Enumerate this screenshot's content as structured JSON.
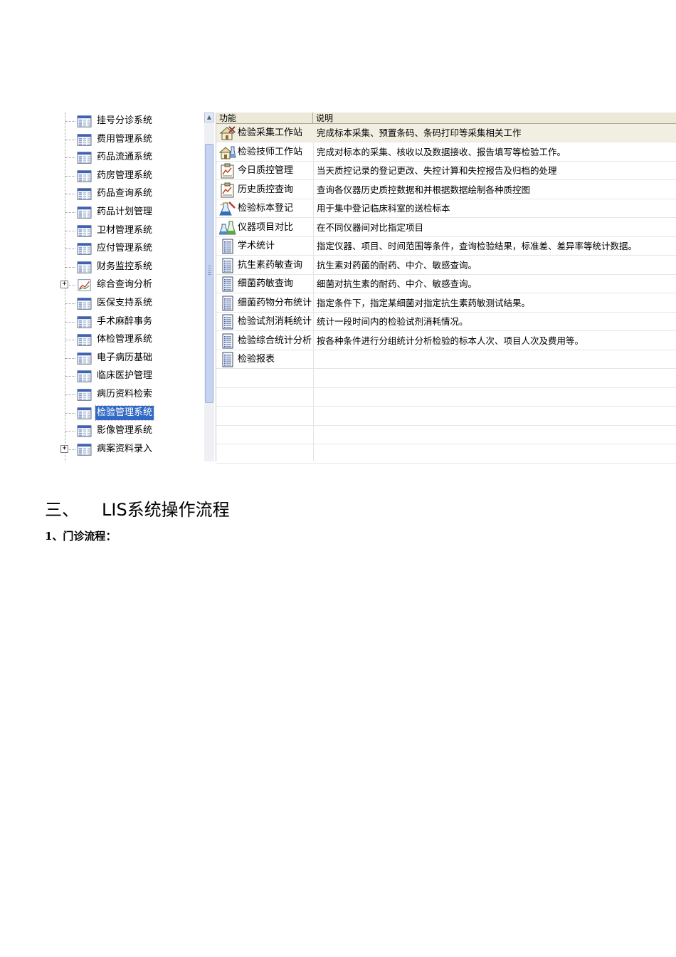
{
  "tree": {
    "items": [
      {
        "label": "挂号分诊系统",
        "expandable": false,
        "selected": false,
        "icon": "table-window-icon"
      },
      {
        "label": "费用管理系统",
        "expandable": false,
        "selected": false,
        "icon": "table-window-icon"
      },
      {
        "label": "药品流通系统",
        "expandable": false,
        "selected": false,
        "icon": "table-window-icon"
      },
      {
        "label": "药房管理系统",
        "expandable": false,
        "selected": false,
        "icon": "table-window-icon"
      },
      {
        "label": "药品查询系统",
        "expandable": false,
        "selected": false,
        "icon": "table-window-icon"
      },
      {
        "label": "药品计划管理",
        "expandable": false,
        "selected": false,
        "icon": "table-window-icon"
      },
      {
        "label": "卫材管理系统",
        "expandable": false,
        "selected": false,
        "icon": "table-window-icon"
      },
      {
        "label": "应付管理系统",
        "expandable": false,
        "selected": false,
        "icon": "table-window-icon"
      },
      {
        "label": "财务监控系统",
        "expandable": false,
        "selected": false,
        "icon": "table-window-icon"
      },
      {
        "label": "综合查询分析",
        "expandable": true,
        "selected": false,
        "icon": "chart-icon"
      },
      {
        "label": "医保支持系统",
        "expandable": false,
        "selected": false,
        "icon": "table-window-icon"
      },
      {
        "label": "手术麻醉事务",
        "expandable": false,
        "selected": false,
        "icon": "table-window-icon"
      },
      {
        "label": "体检管理系统",
        "expandable": false,
        "selected": false,
        "icon": "table-window-icon"
      },
      {
        "label": "电子病历基础",
        "expandable": false,
        "selected": false,
        "icon": "table-window-icon"
      },
      {
        "label": "临床医护管理",
        "expandable": false,
        "selected": false,
        "icon": "table-window-icon"
      },
      {
        "label": "病历资料检索",
        "expandable": false,
        "selected": false,
        "icon": "table-window-icon"
      },
      {
        "label": "检验管理系统",
        "expandable": false,
        "selected": true,
        "icon": "table-window-icon"
      },
      {
        "label": "影像管理系统",
        "expandable": false,
        "selected": false,
        "icon": "table-window-icon"
      },
      {
        "label": "病案资料录入",
        "expandable": true,
        "selected": false,
        "icon": "table-window-icon"
      }
    ],
    "expander_symbol": "+",
    "scroll_up_symbol": "▲"
  },
  "list": {
    "columns": [
      "功能",
      "说明"
    ],
    "rows": [
      {
        "name": "检验采集工作站",
        "desc": "完成标本采集、预置条码、条码打印等采集相关工作",
        "icon": "house-tools-icon",
        "highlighted": true
      },
      {
        "name": "检验技师工作站",
        "desc": "完成对标本的采集、核收以及数据接收、报告填写等检验工作。",
        "icon": "house-flask-icon",
        "highlighted": false
      },
      {
        "name": "今日质控管理",
        "desc": "当天质控记录的登记更改、失控计算和失控报告及归档的处理",
        "icon": "clipboard-chart-icon",
        "highlighted": false
      },
      {
        "name": "历史质控查询",
        "desc": "查询各仪器历史质控数据和并根据数据绘制各种质控图",
        "icon": "clipboard-chart-icon",
        "highlighted": false
      },
      {
        "name": "检验标本登记",
        "desc": "用于集中登记临床科室的送检标本",
        "icon": "flask-pen-icon",
        "highlighted": false
      },
      {
        "name": "仪器项目对比",
        "desc": "在不同仪器间对比指定项目",
        "icon": "flasks-icon",
        "highlighted": false
      },
      {
        "name": "学术统计",
        "desc": "指定仪器、项目、时间范围等条件，查询检验结果，标准差、差异率等统计数据。",
        "icon": "document-list-icon",
        "highlighted": false
      },
      {
        "name": "抗生素药敏查询",
        "desc": "抗生素对药菌的耐药、中介、敏感查询。",
        "icon": "document-list-icon",
        "highlighted": false
      },
      {
        "name": "细菌药敏查询",
        "desc": "细菌对抗生素的耐药、中介、敏感查询。",
        "icon": "document-list-icon",
        "highlighted": false
      },
      {
        "name": "细菌药物分布统计",
        "desc": "指定条件下，指定某细菌对指定抗生素药敏测试结果。",
        "icon": "document-list-icon",
        "highlighted": false
      },
      {
        "name": "检验试剂消耗统计",
        "desc": "统计一段时间内的检验试剂消耗情况。",
        "icon": "document-list-icon",
        "highlighted": false
      },
      {
        "name": "检验综合统计分析",
        "desc": "按各种条件进行分组统计分析检验的标本人次、项目人次及费用等。",
        "icon": "document-list-icon",
        "highlighted": false
      },
      {
        "name": "检验报表",
        "desc": "",
        "icon": "document-list-icon",
        "highlighted": false
      }
    ]
  },
  "document": {
    "section_number": "三、",
    "section_title": "LIS系统操作流程",
    "subsection": "1、门诊流程："
  },
  "colors": {
    "selection": "#316ac5",
    "header_bg": "#ece9d8",
    "highlight_row": "#f1efe2"
  }
}
